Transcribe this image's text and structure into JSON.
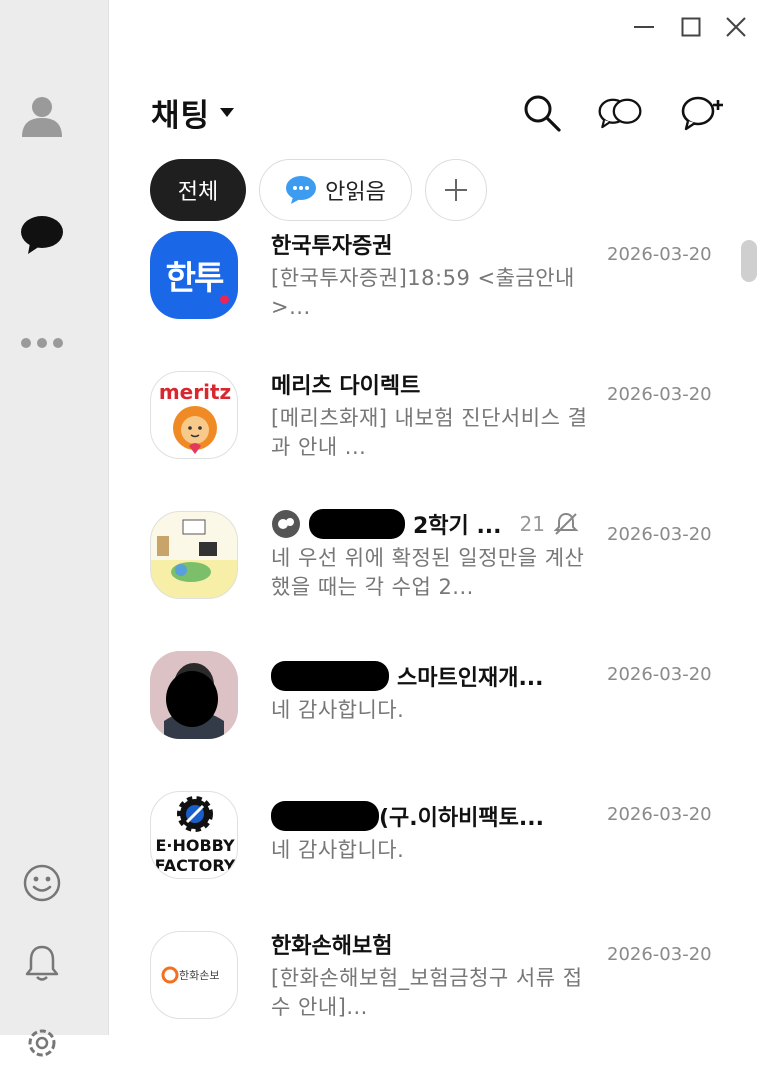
{
  "sidebar": {
    "items": [
      {
        "icon": "person-icon"
      },
      {
        "icon": "chat-bubble-icon"
      },
      {
        "icon": "more-dots-icon"
      },
      {
        "icon": "emoji-icon"
      },
      {
        "icon": "bell-icon"
      },
      {
        "icon": "settings-icon"
      }
    ]
  },
  "window": {
    "minimize": "minimize-icon",
    "maximize": "maximize-icon",
    "close": "close-icon"
  },
  "header": {
    "title": "채팅"
  },
  "filters": {
    "all": "전체",
    "unread": "안읽음"
  },
  "chats": [
    {
      "name": "한국투자증권",
      "preview": "[한국투자증권]18:59 <출금안내>...",
      "date": "2026-03-20",
      "avatar_text": "한투"
    },
    {
      "name": "메리츠 다이렉트",
      "preview": "[메리츠화재] 내보험 진단서비스 결과 안내 ...",
      "date": "2026-03-20",
      "avatar_text": "meritz"
    },
    {
      "name_suffix": "2학기 ...",
      "count": "21",
      "preview": "네 우선 위에 확정된 일정만을 계산했을 때는 각 수업 2...",
      "date": "2026-03-20"
    },
    {
      "name_suffix": "스마트인재개...",
      "preview": "네 감사합니다.",
      "date": "2026-03-20"
    },
    {
      "name_suffix": "(구.이하비팩토...",
      "preview": "네 감사합니다.",
      "date": "2026-03-20",
      "avatar_text_top": "E·HOBBY",
      "avatar_text_bottom": "FACTORY"
    },
    {
      "name": "한화손해보험",
      "preview": "[한화손해보험_보험금청구 서류 접수 안내]...",
      "date": "2026-03-20",
      "avatar_text": "한화손보"
    }
  ]
}
